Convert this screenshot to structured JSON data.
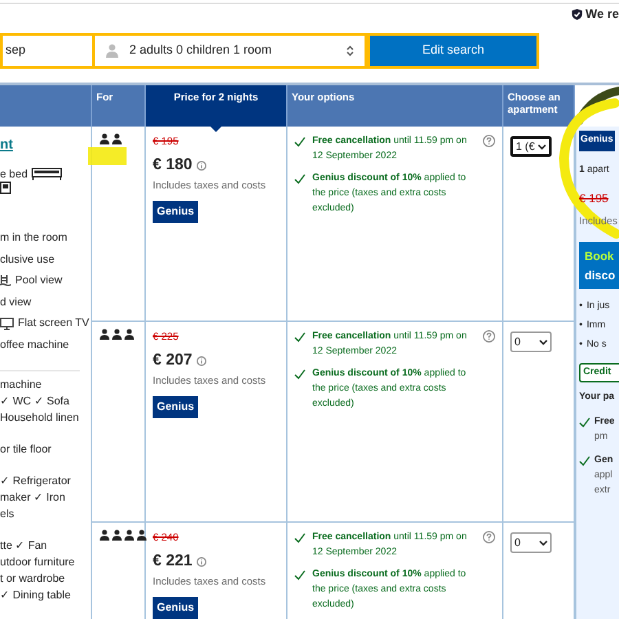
{
  "trust_note": "We re",
  "search": {
    "date_value": "sep",
    "guests_value": "2 adults 0 children 1 room",
    "button": "Edit search"
  },
  "table": {
    "columns": [
      {
        "label": "For",
        "highlighted": false
      },
      {
        "label": "Price for 2 nights",
        "highlighted": true
      },
      {
        "label": "Your options",
        "highlighted": false
      },
      {
        "label": "Choose an apartment",
        "highlighted": false
      }
    ],
    "room": {
      "name": "nt",
      "highlights": [
        [
          {
            "kind": "bed",
            "text": "e bed"
          },
          {
            "kind": "appliance"
          }
        ],
        [
          {
            "kind": "text",
            "text": "m in the room"
          },
          {
            "kind": "text",
            "text": "clusive use"
          },
          {
            "kind": "pool",
            "text": "Pool view"
          },
          {
            "kind": "text",
            "text": "d view"
          },
          {
            "kind": "tv",
            "text": "Flat screen TV"
          },
          {
            "kind": "text",
            "text": "offee machine"
          }
        ]
      ],
      "facilities": [
        [
          "machine",
          "✓ WC ✓ Sofa",
          "Household linen"
        ],
        [
          "or tile floor"
        ],
        [
          "✓ Refrigerator",
          "maker ✓ Iron",
          "els"
        ],
        [
          "tte ✓ Fan",
          "utdoor furniture",
          "t or wardrobe",
          "✓ Dining table"
        ]
      ]
    },
    "rows": [
      {
        "occupancy": [
          {
            "kind": "person"
          },
          {
            "kind": "person"
          }
        ],
        "old_price": "€ 195",
        "price": "€ 180",
        "price_note": "Includes taxes and costs",
        "badge": "Genius",
        "options": [
          "**Free cancellation** until 11.59 pm on 12 September 2022",
          "**Genius discount of 10%** applied to the price (taxes and extra costs excluded)"
        ],
        "select_value": "1 (€",
        "focused": true
      },
      {
        "occupancy": [
          {
            "kind": "person"
          },
          {
            "kind": "person"
          },
          {
            "kind": "person"
          }
        ],
        "old_price": "€ 225",
        "price": "€ 207",
        "price_note": "Includes taxes and costs",
        "badge": "Genius",
        "options": [
          "**Free cancellation** until 11.59 pm on 12 September 2022",
          "**Genius discount of 10%** applied to the price (taxes and extra costs excluded)"
        ],
        "select_value": "0",
        "focused": false
      },
      {
        "occupancy": [
          {
            "kind": "person"
          },
          {
            "kind": "person"
          },
          {
            "kind": "person"
          },
          {
            "kind": "person"
          }
        ],
        "old_price": "€ 240",
        "price": "€ 221",
        "price_note": "Includes taxes and costs",
        "badge": "Genius",
        "options": [
          "**Free cancellation** until 11.59 pm on 12 September 2022",
          "**Genius discount of 10%** applied to the price (taxes and extra costs excluded)"
        ],
        "select_value": "0",
        "focused": false
      }
    ]
  },
  "summary": {
    "badge": "Genius",
    "count": "**1** apart",
    "old_price": "€ 195",
    "note": "Includes",
    "button_lines": [
      "Book",
      "disco"
    ],
    "bullets": [
      {
        "marker": "•",
        "text": "In jus"
      },
      {
        "marker": "•",
        "text": "Imm"
      },
      {
        "marker": "•",
        "text": "No s"
      }
    ],
    "credit": "Credit",
    "package_title": "Your pa",
    "package_items": [
      [
        "Free",
        "pm"
      ],
      [
        "Gen",
        "appl",
        "extr"
      ]
    ]
  }
}
